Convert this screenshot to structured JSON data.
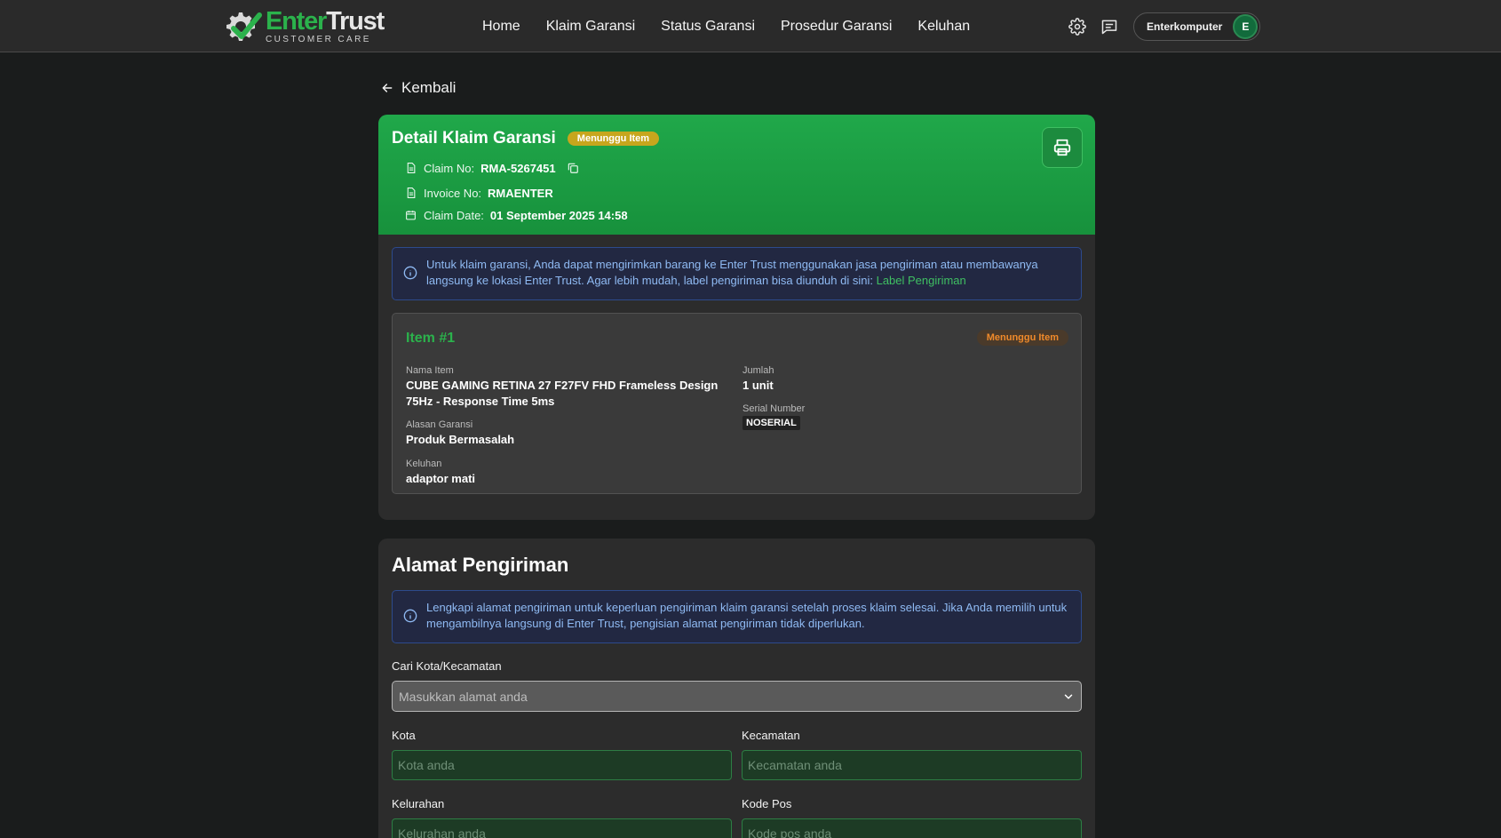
{
  "brand": {
    "name_part1": "Enter",
    "name_part2": "Trust",
    "tagline": "CUSTOMER CARE"
  },
  "nav": {
    "links": [
      "Home",
      "Klaim Garansi",
      "Status Garansi",
      "Prosedur Garansi",
      "Keluhan"
    ]
  },
  "user": {
    "name": "Enterkomputer",
    "initial": "E"
  },
  "back_label": "Kembali",
  "claim": {
    "title": "Detail Klaim Garansi",
    "status_badge": "Menunggu Item",
    "claim_no_label": "Claim No:",
    "claim_no": "RMA-5267451",
    "invoice_no_label": "Invoice No:",
    "invoice_no": "RMAENTER",
    "claim_date_label": "Claim Date:",
    "claim_date": "01 September 2025 14:58",
    "info_text": "Untuk klaim garansi, Anda dapat mengirimkan barang ke Enter Trust menggunakan jasa pengiriman atau membawanya langsung ke lokasi Enter Trust. Agar lebih mudah, label pengiriman bisa diunduh di sini: ",
    "info_link": "Label Pengiriman"
  },
  "item": {
    "title": "Item #1",
    "status_badge": "Menunggu Item",
    "nama_label": "Nama Item",
    "nama_line1": "CUBE GAMING RETINA 27 F27FV FHD Frameless Design",
    "nama_line2": "75Hz - Response Time 5ms",
    "jumlah_label": "Jumlah",
    "jumlah": "1 unit",
    "serial_label": "Serial Number",
    "serial": "NOSERIAL",
    "alasan_label": "Alasan Garansi",
    "alasan": "Produk Bermasalah",
    "keluhan_label": "Keluhan",
    "keluhan": "adaptor mati"
  },
  "address": {
    "title": "Alamat Pengiriman",
    "info_text": "Lengkapi alamat pengiriman untuk keperluan pengiriman klaim garansi setelah proses klaim selesai. Jika Anda memilih untuk mengambilnya langsung di Enter Trust, pengisian alamat pengiriman tidak diperlukan.",
    "search_label": "Cari Kota/Kecamatan",
    "search_placeholder": "Masukkan alamat anda",
    "kota_label": "Kota",
    "kota_placeholder": "Kota anda",
    "kecamatan_label": "Kecamatan",
    "kecamatan_placeholder": "Kecamatan anda",
    "kelurahan_label": "Kelurahan",
    "kelurahan_placeholder": "Kelurahan anda",
    "kodepos_label": "Kode Pos",
    "kodepos_placeholder": "Kode pos anda"
  },
  "colors": {
    "accent": "#2bb24c",
    "header_green": "#1a9d43",
    "info_blue": "#8fbaf3",
    "badge_yellow": "#c7a61d",
    "badge_orange": "#f08a2a"
  }
}
